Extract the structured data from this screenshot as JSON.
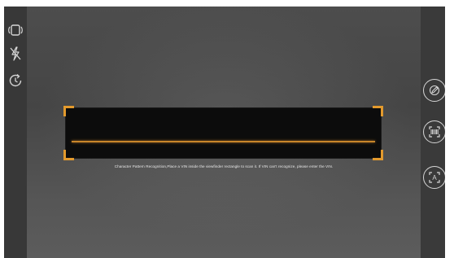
{
  "scanner": {
    "hint": "Character Pattern Recognition,Place a VIN inside the viewfinder rectangle to scan it. If VIN can't recognize, please enter the VIN."
  },
  "left_toolbar": {
    "icons": [
      "rotate-screen-icon",
      "flash-off-icon",
      "history-icon"
    ]
  },
  "right_toolbar": {
    "buttons": [
      "manual-input-icon",
      "barcode-scan-icon",
      "text-recognition-icon"
    ],
    "text_recognition_glyph": "A"
  },
  "colors": {
    "accent": "#e39a2d",
    "scan_line": "#c8862a",
    "icon": "#d6d6d6"
  }
}
